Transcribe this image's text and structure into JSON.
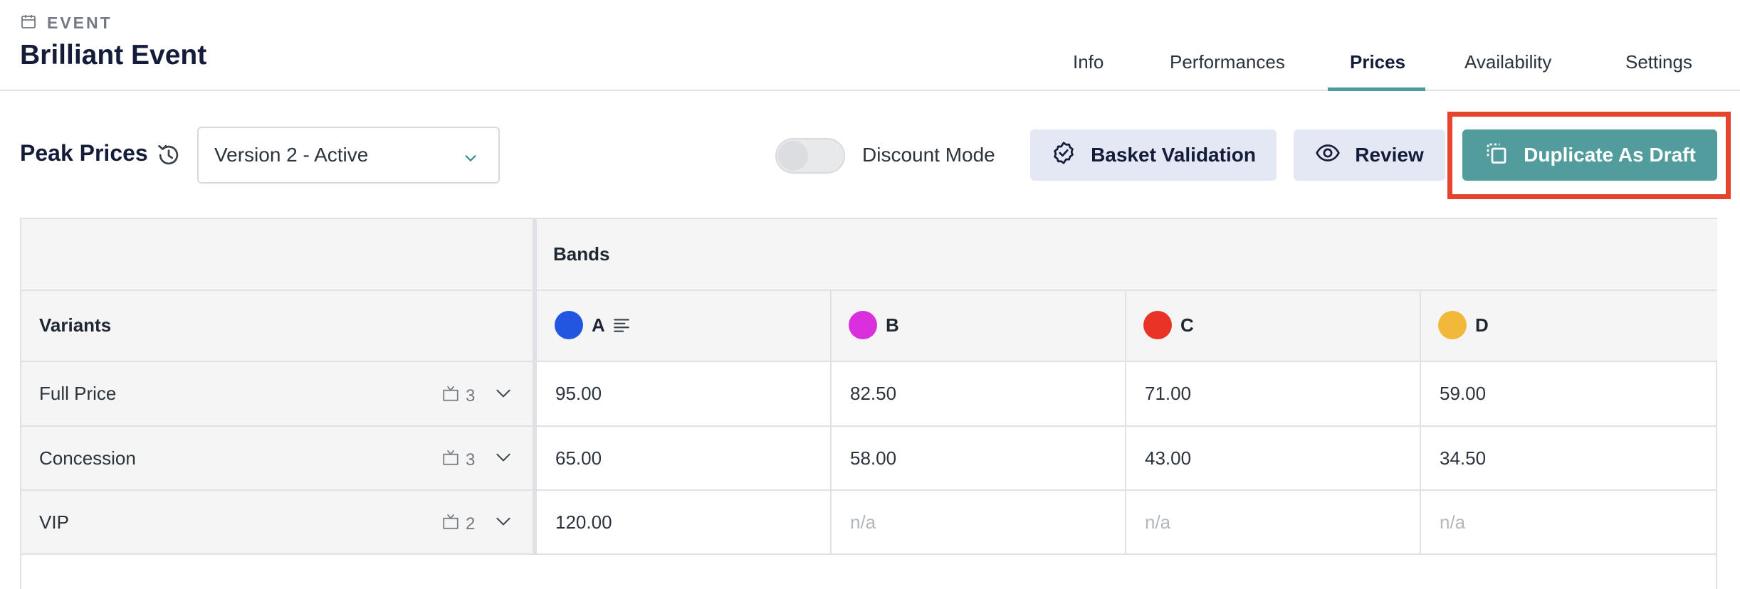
{
  "header": {
    "breadcrumb": "EVENT",
    "title": "Brilliant Event",
    "tabs": [
      {
        "label": "Info",
        "active": false
      },
      {
        "label": "Performances",
        "active": false
      },
      {
        "label": "Prices",
        "active": true
      },
      {
        "label": "Availability",
        "active": false
      },
      {
        "label": "Settings",
        "active": false
      }
    ]
  },
  "toolbar": {
    "title": "Peak Prices",
    "version_select": "Version 2 - Active",
    "discount_mode_label": "Discount Mode",
    "discount_mode_on": false,
    "basket_validation_label": "Basket Validation",
    "review_label": "Review",
    "duplicate_label": "Duplicate As Draft"
  },
  "table": {
    "bands_header": "Bands",
    "variants_header": "Variants",
    "bands": [
      {
        "name": "A",
        "color": "#2356e0"
      },
      {
        "name": "B",
        "color": "#d92fdc"
      },
      {
        "name": "C",
        "color": "#e83326"
      },
      {
        "name": "D",
        "color": "#f2b83a"
      }
    ],
    "rows": [
      {
        "variant": "Full Price",
        "count": "3",
        "prices": [
          "95.00",
          "82.50",
          "71.00",
          "59.00"
        ]
      },
      {
        "variant": "Concession",
        "count": "3",
        "prices": [
          "65.00",
          "58.00",
          "43.00",
          "34.50"
        ]
      },
      {
        "variant": "VIP",
        "count": "2",
        "prices": [
          "120.00",
          "n/a",
          "n/a",
          "n/a"
        ]
      }
    ]
  },
  "colors": {
    "accent": "#529c9d",
    "highlight": "#e4452c",
    "soft_button": "#e4e8f5"
  },
  "icons": {
    "breadcrumb": "calendar-icon",
    "history": "history-icon",
    "select": "chevron-down-icon",
    "basket": "badge-check-icon",
    "review": "eye-icon",
    "duplicate": "duplicate-icon",
    "band_a_extra": "description-lines-icon",
    "variant_count": "channel-icon"
  }
}
